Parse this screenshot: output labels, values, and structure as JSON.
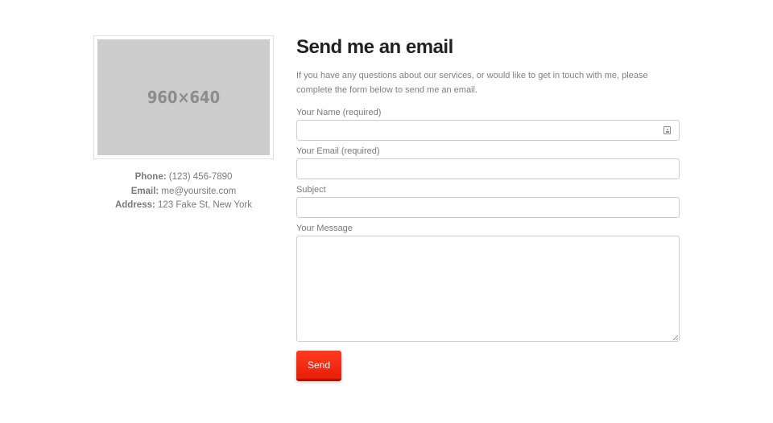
{
  "sidebar": {
    "image_placeholder_text": "960×640",
    "contact": [
      {
        "label": "Phone:",
        "value": " (123) 456-7890"
      },
      {
        "label": "Email:",
        "value": " me@yoursite.com"
      },
      {
        "label": "Address:",
        "value": " 123 Fake St, New York"
      }
    ]
  },
  "main": {
    "title": "Send me an email",
    "intro": "If you have any questions about our services, or would like to get in touch with me, please complete the form below to send me an email.",
    "form": {
      "name_label": "Your Name (required)",
      "name_value": "",
      "email_label": "Your Email (required)",
      "email_value": "",
      "subject_label": "Subject",
      "subject_value": "",
      "message_label": "Your Message",
      "message_value": "",
      "submit_label": "Send",
      "name_icon": "contact-card-icon"
    }
  },
  "colors": {
    "accent": "#f42a11",
    "title": "#222222",
    "text": "#7a7a7a",
    "placeholder_bg": "#cccccc",
    "input_border": "#cfcfcf"
  }
}
